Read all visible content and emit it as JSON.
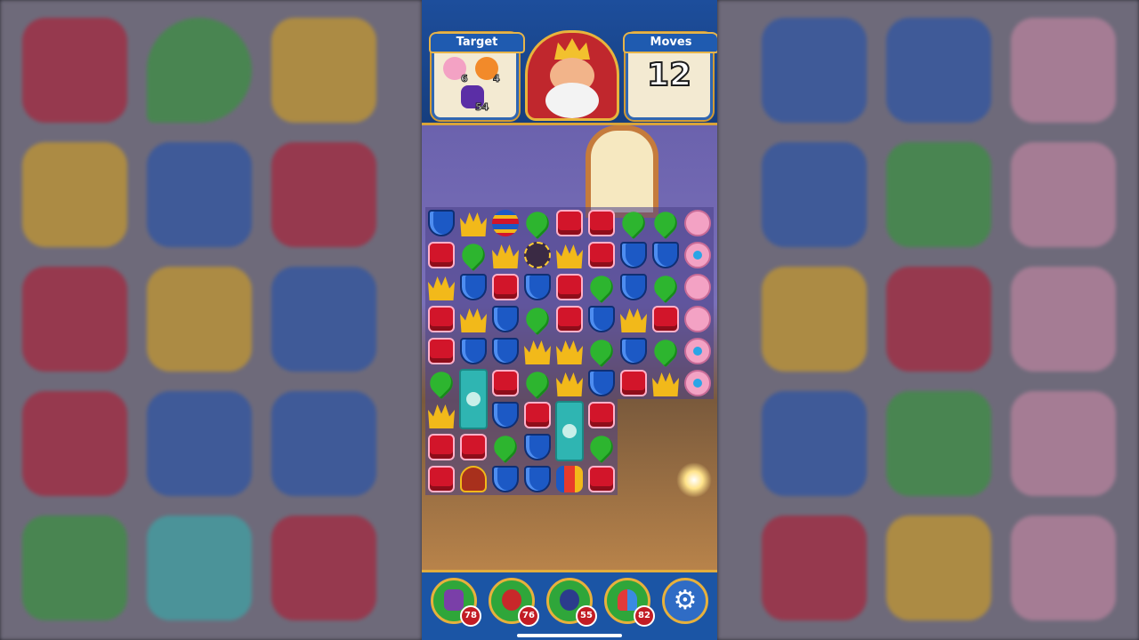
{
  "header": {
    "target_label": "Target",
    "moves_label": "Moves",
    "moves_value": "12",
    "targets": [
      {
        "icon": "pearl-shell-icon",
        "count": "6"
      },
      {
        "icon": "teddy-bear-icon",
        "count": "4"
      },
      {
        "icon": "purple-tile-icon",
        "count": "54"
      }
    ]
  },
  "boosters": [
    {
      "icon": "hammer-icon",
      "count": "78"
    },
    {
      "icon": "crossbow-icon",
      "count": "76"
    },
    {
      "icon": "cannon-icon",
      "count": "55"
    },
    {
      "icon": "jester-hat-icon",
      "count": "82"
    }
  ],
  "settings_icon": "gear-icon",
  "colors": {
    "red": "#d2152a",
    "blue": "#1c59c5",
    "green": "#2db52f",
    "yellow": "#f2b91a",
    "pink": "#f3a2c4",
    "accent_gold": "#e2ad3d",
    "bar_blue": "#1b55a5"
  },
  "board": {
    "rows": [
      [
        "blue",
        "crown",
        "striped",
        "green",
        "red",
        "red",
        "green",
        "green",
        "shell"
      ],
      [
        "red",
        "green",
        "crown",
        "bomb",
        "crown",
        "red",
        "blue",
        "blue",
        "pearl"
      ],
      [
        "crown",
        "blue",
        "red",
        "blue",
        "red",
        "green",
        "blue",
        "green",
        "shell"
      ],
      [
        "red",
        "crown",
        "blue",
        "green",
        "red",
        "blue",
        "crown",
        "red",
        "shell"
      ],
      [
        "red",
        "blue",
        "blue",
        "crown",
        "crown",
        "green",
        "blue",
        "green",
        "pearl"
      ],
      [
        "green",
        "ice",
        "red",
        "green",
        "crown",
        "blue",
        "red",
        "crown",
        "pearl"
      ],
      [
        "crown",
        "ice",
        "blue",
        "red",
        "ice",
        "red",
        "",
        "",
        ""
      ],
      [
        "red",
        "red",
        "green",
        "blue",
        "ice",
        "green",
        "",
        "",
        ""
      ],
      [
        "red",
        "chest",
        "blue",
        "blue",
        "rocket",
        "red",
        "",
        "",
        ""
      ]
    ]
  }
}
